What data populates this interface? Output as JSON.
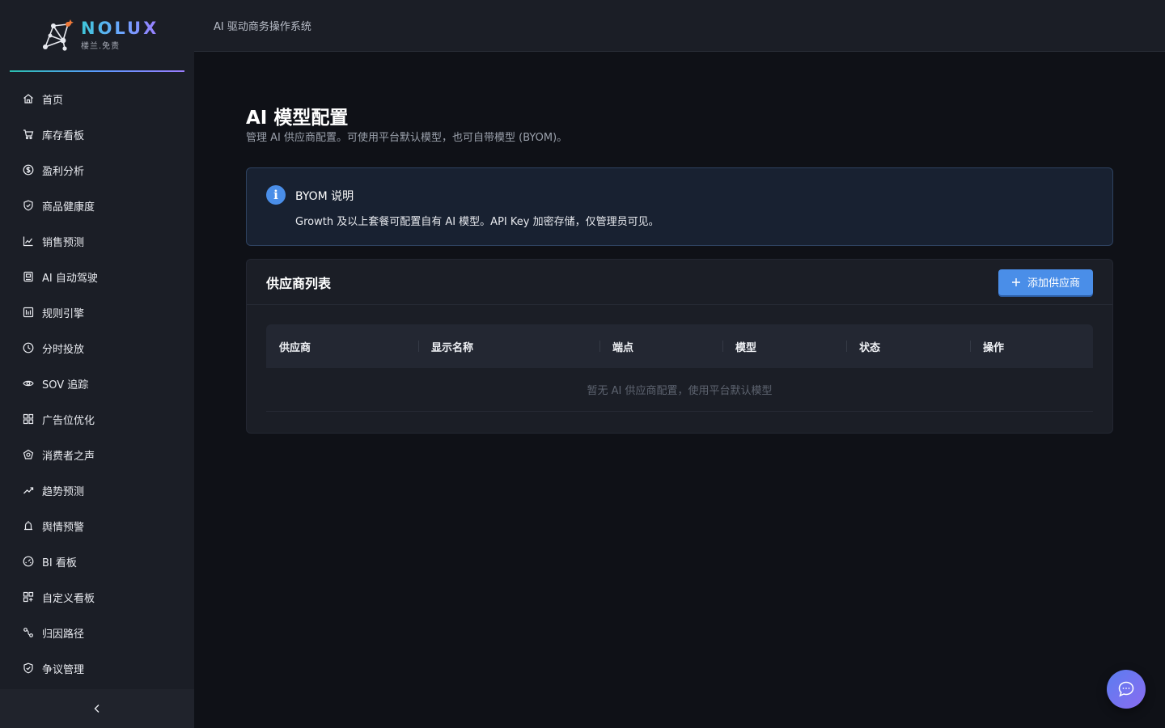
{
  "brand": {
    "name": "NOLUX",
    "subtitle": "楼兰.免责"
  },
  "header": {
    "title": "AI 驱动商务操作系统"
  },
  "sidebar": {
    "items": [
      {
        "label": "首页",
        "icon": "home-icon"
      },
      {
        "label": "库存看板",
        "icon": "cart-icon"
      },
      {
        "label": "盈利分析",
        "icon": "dollar-icon"
      },
      {
        "label": "商品健康度",
        "icon": "shield-check-icon"
      },
      {
        "label": "销售预测",
        "icon": "line-chart-icon"
      },
      {
        "label": "AI 自动驾驶",
        "icon": "robot-icon"
      },
      {
        "label": "规则引擎",
        "icon": "rules-icon"
      },
      {
        "label": "分时投放",
        "icon": "clock-icon"
      },
      {
        "label": "SOV 追踪",
        "icon": "eye-icon"
      },
      {
        "label": "广告位优化",
        "icon": "grid-icon"
      },
      {
        "label": "消费者之声",
        "icon": "voice-icon"
      },
      {
        "label": "趋势预测",
        "icon": "trend-icon"
      },
      {
        "label": "舆情预警",
        "icon": "alarm-icon"
      },
      {
        "label": "BI 看板",
        "icon": "dashboard-icon"
      },
      {
        "label": "自定义看板",
        "icon": "custom-board-icon"
      },
      {
        "label": "归因路径",
        "icon": "path-icon"
      },
      {
        "label": "争议管理",
        "icon": "shield-icon"
      }
    ]
  },
  "page": {
    "title": "AI 模型配置",
    "description": "管理 AI 供应商配置。可使用平台默认模型，也可自带模型 (BYOM)。"
  },
  "info": {
    "icon_glyph": "i",
    "title": "BYOM 说明",
    "text": "Growth 及以上套餐可配置自有 AI 模型。API Key 加密存储，仅管理员可见。"
  },
  "providers": {
    "title": "供应商列表",
    "add_label": "添加供应商",
    "columns": [
      "供应商",
      "显示名称",
      "端点",
      "模型",
      "状态",
      "操作"
    ],
    "empty_text": "暂无 AI 供应商配置，使用平台默认模型"
  },
  "colors": {
    "accent": "#4a8ee8",
    "background": "#0f1117",
    "sidebar": "#1b1e26",
    "info_bg": "#182131"
  }
}
